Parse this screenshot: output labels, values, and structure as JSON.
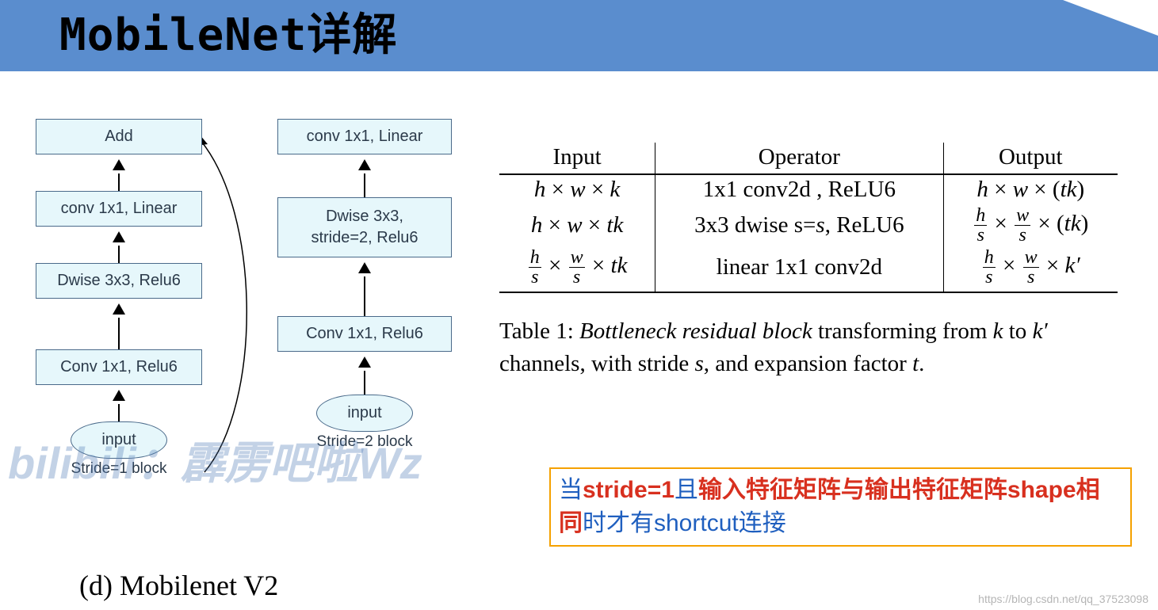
{
  "title": "MobileNet详解",
  "diagram": {
    "left": {
      "blocks": [
        "Add",
        "conv 1x1, Linear",
        "Dwise 3x3, Relu6",
        "Conv 1x1, Relu6"
      ],
      "input": "input",
      "caption": "Stride=1 block"
    },
    "right": {
      "blocks": [
        "conv 1x1, Linear",
        "Dwise 3x3, stride=2, Relu6",
        "Conv 1x1, Relu6"
      ],
      "input": "input",
      "caption": "Stride=2 block"
    },
    "footer": "(d) Mobilenet V2"
  },
  "table": {
    "headers": [
      "Input",
      "Operator",
      "Output"
    ],
    "rows": [
      {
        "input_html": "<i>h</i> × <i>w</i> × <i>k</i>",
        "operator": "1x1 conv2d , ReLU6",
        "output_html": "<i>h</i> × <i>w</i> × (<i>tk</i>)"
      },
      {
        "input_html": "<i>h</i> × <i>w</i> × <i>tk</i>",
        "operator_html": "3x3 dwise s=<i>s</i>, ReLU6",
        "output_html": "<span class=\"frac\"><span class=\"num\"><i>h</i></span><span class=\"den\"><i>s</i></span></span> × <span class=\"frac\"><span class=\"num\"><i>w</i></span><span class=\"den\"><i>s</i></span></span> × (<i>tk</i>)"
      },
      {
        "input_html": "<span class=\"frac\"><span class=\"num\"><i>h</i></span><span class=\"den\"><i>s</i></span></span> × <span class=\"frac\"><span class=\"num\"><i>w</i></span><span class=\"den\"><i>s</i></span></span> × <i>tk</i>",
        "operator": "linear 1x1 conv2d",
        "output_html": "<span class=\"frac\"><span class=\"num\"><i>h</i></span><span class=\"den\"><i>s</i></span></span> × <span class=\"frac\"><span class=\"num\"><i>w</i></span><span class=\"den\"><i>s</i></span></span> × <i>k′</i>"
      }
    ],
    "caption_html": "Table 1: <i>Bottleneck residual block</i> transforming from <i>k</i> to <i>k′</i> channels, with stride <i>s</i>, and expansion factor <i>t</i>."
  },
  "note": {
    "p1_blue": "当",
    "p1_red": "stride=1",
    "p2_blue": "且",
    "p2_red": "输入特征矩阵与输出特征矩阵shape相同",
    "p3_blue": "时才有shortcut连接"
  },
  "watermark": "bilibili：霹雳吧啦Wz",
  "url_mark": "https://blog.csdn.net/qq_37523098"
}
